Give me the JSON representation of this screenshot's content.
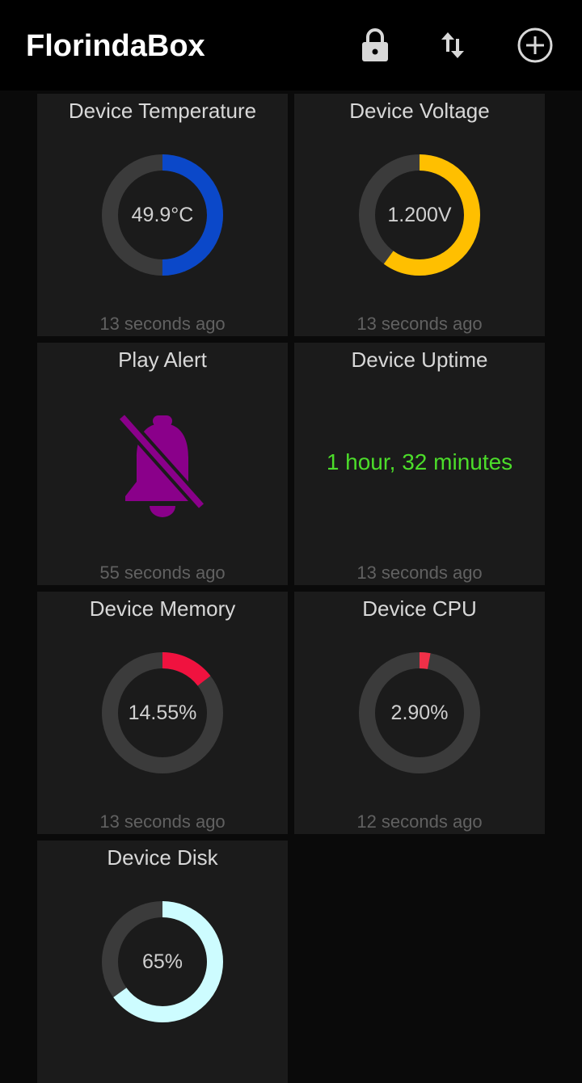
{
  "app": {
    "title": "FlorindaBox",
    "icons": [
      "lock-icon",
      "swap-vertical-icon",
      "add-circle-icon"
    ]
  },
  "tiles": [
    {
      "title": "Device Temperature",
      "type": "gauge",
      "value_text": "49.9°C",
      "fraction": 0.5,
      "color": "#0b48c9",
      "updated": "13 seconds ago"
    },
    {
      "title": "Device Voltage",
      "type": "gauge",
      "value_text": "1.200V",
      "fraction": 0.6,
      "color": "#ffbf00",
      "updated": "13 seconds ago"
    },
    {
      "title": "Play Alert",
      "type": "icon",
      "icon": "bell-off-icon",
      "color": "#8a008a",
      "updated": "55 seconds ago"
    },
    {
      "title": "Device Uptime",
      "type": "text",
      "value_text": "1 hour, 32 minutes",
      "color": "#4cdd2a",
      "updated": "13 seconds ago"
    },
    {
      "title": "Device Memory",
      "type": "gauge",
      "value_text": "14.55%",
      "fraction": 0.1455,
      "color": "#f0123f",
      "updated": "13 seconds ago"
    },
    {
      "title": "Device CPU",
      "type": "gauge",
      "value_text": "2.90%",
      "fraction": 0.029,
      "color": "#f03048",
      "updated": "12 seconds ago"
    },
    {
      "title": "Device Disk",
      "type": "gauge",
      "value_text": "65%",
      "fraction": 0.65,
      "color": "#cdfcff",
      "updated": ""
    }
  ],
  "colors": {
    "track": "#3b3b3b",
    "tile_bg": "#1b1b1b",
    "bar_bg": "#000000"
  }
}
